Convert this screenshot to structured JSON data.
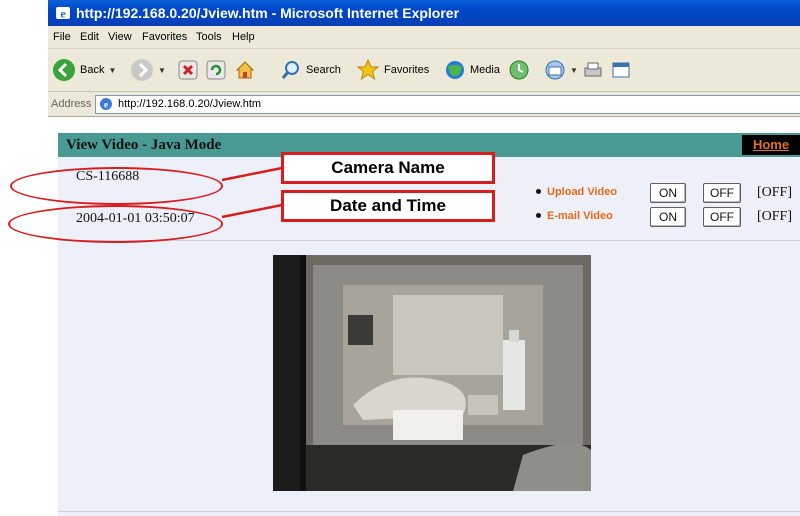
{
  "window": {
    "title": "http://192.168.0.20/Jview.htm - Microsoft Internet Explorer"
  },
  "menubar": {
    "items": [
      "File",
      "Edit",
      "View",
      "Favorites",
      "Tools",
      "Help"
    ]
  },
  "toolbar": {
    "back_label": "Back",
    "search_label": "Search",
    "favorites_label": "Favorites",
    "media_label": "Media"
  },
  "addressbar": {
    "label": "Address",
    "url": "http://192.168.0.20/Jview.htm"
  },
  "page": {
    "title": "View Video - Java Mode",
    "home_link": "Home",
    "camera_name": "CS-116688",
    "datetime": "2004-01-01 03:50:07",
    "options": [
      {
        "label": "Upload Video",
        "on_label": "ON",
        "off_label": "OFF",
        "state": "[OFF]"
      },
      {
        "label": "E-mail Video",
        "on_label": "ON",
        "off_label": "OFF",
        "state": "[OFF]"
      }
    ]
  },
  "annotations": {
    "camera_name_callout": "Camera Name",
    "datetime_callout": "Date and Time",
    "color": "#d81d1d"
  }
}
